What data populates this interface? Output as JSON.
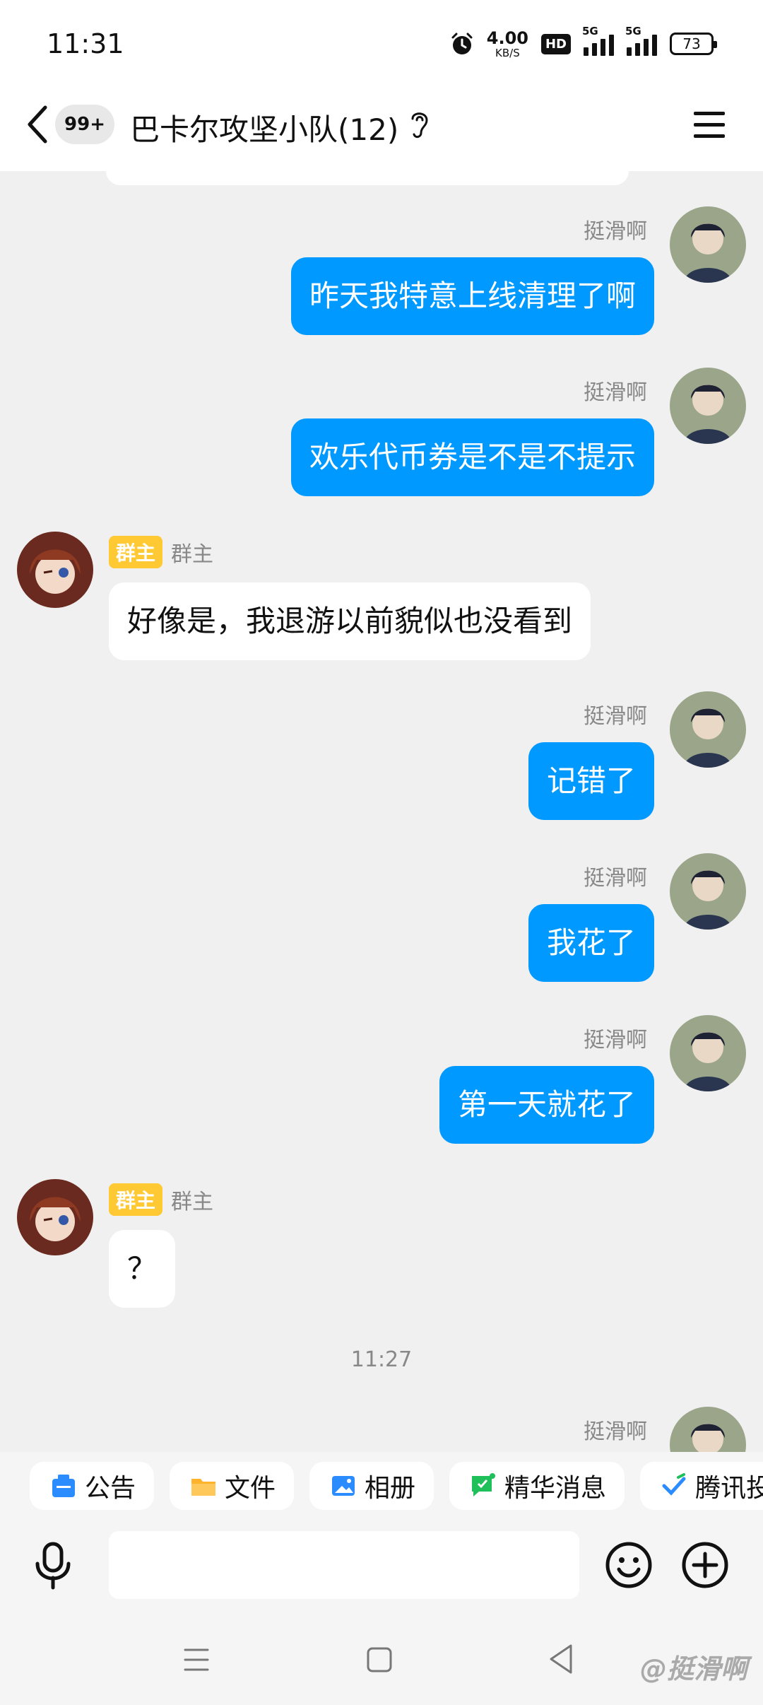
{
  "status": {
    "time": "11:31",
    "net_speed_value": "4.00",
    "net_speed_unit": "KB/S",
    "hd": "HD",
    "network": "5G",
    "battery": "73"
  },
  "header": {
    "unread": "99+",
    "title": "巴卡尔攻坚小队(12)"
  },
  "messages": [
    {
      "side": "right",
      "sender": "挺滑啊",
      "text": "昨天我特意上线清理了啊"
    },
    {
      "side": "right",
      "sender": "挺滑啊",
      "text": "欢乐代币券是不是不提示"
    },
    {
      "side": "left",
      "badge": "群主",
      "sender": "群主",
      "text": "好像是，我退游以前貌似也没看到"
    },
    {
      "side": "right",
      "sender": "挺滑啊",
      "text": "记错了"
    },
    {
      "side": "right",
      "sender": "挺滑啊",
      "text": "我花了"
    },
    {
      "side": "right",
      "sender": "挺滑啊",
      "text": "第一天就花了"
    },
    {
      "side": "left",
      "badge": "群主",
      "sender": "群主",
      "text": "？"
    },
    {
      "side": "time",
      "text": "11:27"
    },
    {
      "side": "right",
      "sender": "挺滑啊",
      "text": ""
    }
  ],
  "tools": [
    "公告",
    "文件",
    "相册",
    "精华消息",
    "腾讯投票"
  ],
  "input": {
    "placeholder": ""
  },
  "watermark": "@挺滑啊",
  "colors": {
    "accent": "#0099ff",
    "owner_badge": "#ffc933",
    "background": "#f0f0f0"
  }
}
